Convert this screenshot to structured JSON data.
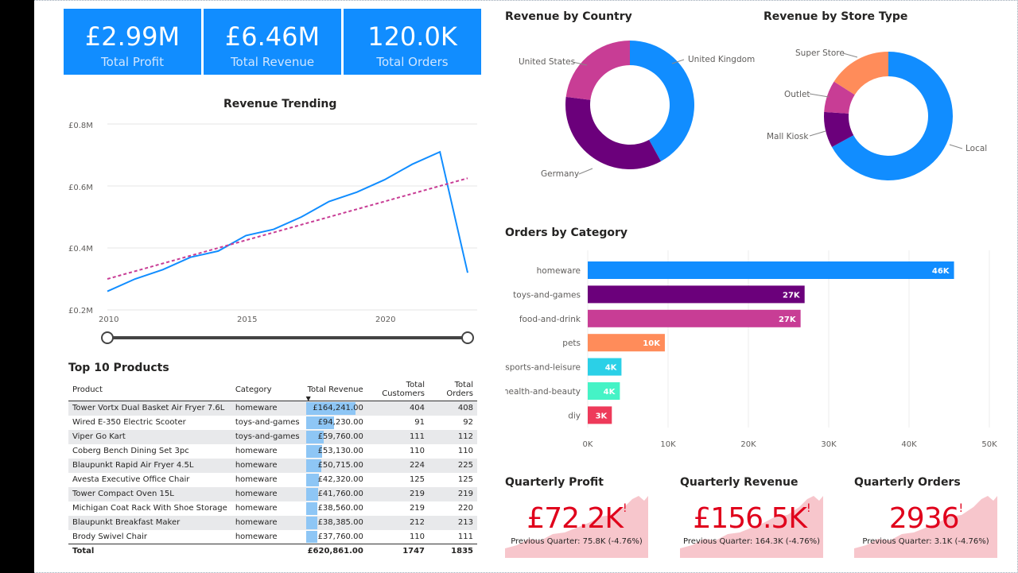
{
  "cards": [
    {
      "value": "£2.99M",
      "label": "Total Profit"
    },
    {
      "value": "£6.46M",
      "label": "Total Revenue"
    },
    {
      "value": "120.0K",
      "label": "Total Orders"
    }
  ],
  "colors": {
    "blue": "#118DFF",
    "purple": "#6B007B",
    "magenta": "#C83D95",
    "orange": "#FF8C5A",
    "cyan": "#2BD0E7",
    "mint": "#45F3C6",
    "red": "#EE3A5A",
    "kpi_red": "#E0001B"
  },
  "revenue_trending": {
    "title": "Revenue Trending",
    "y_ticks": [
      "£0.8M",
      "£0.6M",
      "£0.4M",
      "£0.2M"
    ],
    "x_ticks": [
      "2010",
      "2015",
      "2020"
    ]
  },
  "products": {
    "title": "Top 10 Products",
    "columns": [
      "Product",
      "Category",
      "Total Revenue",
      "Total Customers",
      "Total Orders"
    ],
    "rows": [
      {
        "product": "Tower Vortx Dual Basket Air Fryer 7.6L",
        "category": "homeware",
        "revenue": "£164,241.00",
        "revenue_value": 164241,
        "customers": "404",
        "orders": "408"
      },
      {
        "product": "Wired E-350 Electric Scooter",
        "category": "toys-and-games",
        "revenue": "£94,230.00",
        "revenue_value": 94230,
        "customers": "91",
        "orders": "92"
      },
      {
        "product": "Viper Go Kart",
        "category": "toys-and-games",
        "revenue": "£59,760.00",
        "revenue_value": 59760,
        "customers": "111",
        "orders": "112"
      },
      {
        "product": "Coberg Bench Dining Set 3pc",
        "category": "homeware",
        "revenue": "£53,130.00",
        "revenue_value": 53130,
        "customers": "110",
        "orders": "110"
      },
      {
        "product": "Blaupunkt Rapid Air Fryer 4.5L",
        "category": "homeware",
        "revenue": "£50,715.00",
        "revenue_value": 50715,
        "customers": "224",
        "orders": "225"
      },
      {
        "product": "Avesta Executive Office Chair",
        "category": "homeware",
        "revenue": "£42,320.00",
        "revenue_value": 42320,
        "customers": "125",
        "orders": "125"
      },
      {
        "product": "Tower Compact Oven 15L",
        "category": "homeware",
        "revenue": "£41,760.00",
        "revenue_value": 41760,
        "customers": "219",
        "orders": "219"
      },
      {
        "product": "Michigan Coat Rack With Shoe Storage",
        "category": "homeware",
        "revenue": "£38,560.00",
        "revenue_value": 38560,
        "customers": "219",
        "orders": "220"
      },
      {
        "product": "Blaupunkt Breakfast Maker",
        "category": "homeware",
        "revenue": "£38,385.00",
        "revenue_value": 38385,
        "customers": "212",
        "orders": "213"
      },
      {
        "product": "Brody Swivel Chair",
        "category": "homeware",
        "revenue": "£37,760.00",
        "revenue_value": 37760,
        "customers": "110",
        "orders": "111"
      }
    ],
    "total": {
      "label": "Total",
      "revenue": "£620,861.00",
      "customers": "1747",
      "orders": "1835"
    }
  },
  "country_title": "Revenue by Country",
  "store_title": "Revenue by Store Type",
  "category_title": "Orders by Category",
  "kpis": [
    {
      "title": "Quarterly Profit",
      "value": "£72.2K",
      "sub": "Previous Quarter: 75.8K (-4.76%)"
    },
    {
      "title": "Quarterly Revenue",
      "value": "£156.5K",
      "sub": "Previous Quarter: 164.3K (-4.76%)"
    },
    {
      "title": "Quarterly Orders",
      "value": "2936",
      "sub": "Previous Quarter: 3.1K (-4.76%)"
    }
  ],
  "chart_data": [
    {
      "type": "line",
      "title": "Revenue Trending",
      "x": [
        2010,
        2011,
        2012,
        2013,
        2014,
        2015,
        2016,
        2017,
        2018,
        2019,
        2020,
        2021,
        2022,
        2023
      ],
      "series": [
        {
          "values": [
            0.26,
            0.3,
            0.33,
            0.37,
            0.39,
            0.44,
            0.46,
            0.5,
            0.55,
            0.58,
            0.62,
            0.67,
            0.71,
            0.32
          ]
        },
        {
          "values": [
            0.3,
            0.325,
            0.35,
            0.375,
            0.4,
            0.425,
            0.45,
            0.475,
            0.5,
            0.525,
            0.55,
            0.575,
            0.6,
            0.625
          ]
        }
      ],
      "ylim": [
        0.2,
        0.8
      ],
      "xlim": [
        2010,
        2023
      ],
      "grid": true
    },
    {
      "type": "pie",
      "title": "Revenue by Country",
      "categories": [
        "United Kingdom",
        "Germany",
        "United States"
      ],
      "values": [
        42,
        35,
        23
      ],
      "donut": true
    },
    {
      "type": "pie",
      "title": "Revenue by Store Type",
      "categories": [
        "Local",
        "Mall Kiosk",
        "Outlet",
        "Super Store"
      ],
      "values": [
        67,
        9,
        8,
        16
      ],
      "donut": true
    },
    {
      "type": "bar",
      "orientation": "horizontal",
      "title": "Orders by Category",
      "categories": [
        "homeware",
        "toys-and-games",
        "food-and-drink",
        "pets",
        "sports-and-leisure",
        "health-and-beauty",
        "diy"
      ],
      "values": [
        45.6,
        27,
        26.5,
        9.6,
        4.2,
        4.0,
        3.0
      ],
      "data_labels": [
        "46K",
        "27K",
        "27K",
        "10K",
        "4K",
        "4K",
        "3K"
      ],
      "x_ticks": [
        "0K",
        "10K",
        "20K",
        "30K",
        "40K",
        "50K"
      ],
      "xlim": [
        0,
        50
      ],
      "grid": true
    }
  ]
}
